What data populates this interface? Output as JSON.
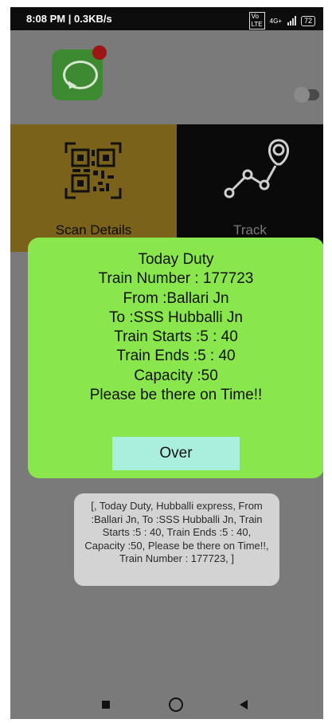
{
  "status_bar": {
    "time": "8:08 PM | 0.3KB/s",
    "battery": "72",
    "network": "4G+",
    "icons": [
      "volte-icon",
      "signal-icon",
      "battery-icon"
    ]
  },
  "tiles": [
    {
      "label": "Scan Details",
      "icon": "qr-code-icon"
    },
    {
      "label": "Track",
      "icon": "route-icon"
    }
  ],
  "dialog": {
    "lines": [
      "Today Duty",
      "Train Number : 177723",
      "From :Ballari Jn",
      "To :SSS Hubballi Jn",
      "Train Starts :5 : 40",
      "Train Ends :5 : 40",
      "Capacity :50",
      "Please be there on Time!!"
    ],
    "button_label": "Over"
  },
  "toast": {
    "text": "[, Today Duty,  Hubballi express, From :Ballari Jn,  To :SSS Hubballi Jn,  Train Starts :5 : 40,  Train Ends :5 : 40,  Capacity :50,  Please be there on Time!!,  Train Number : 177723, ]"
  },
  "colors": {
    "dialog_background": "#8ae64d",
    "button_background": "#aaeedd",
    "scan_tile": "#7a621a",
    "track_tile": "#0a0a0a",
    "dim_overlay": "#7a7a7a"
  },
  "nav_bar": [
    "recents-button",
    "home-button",
    "back-button"
  ]
}
